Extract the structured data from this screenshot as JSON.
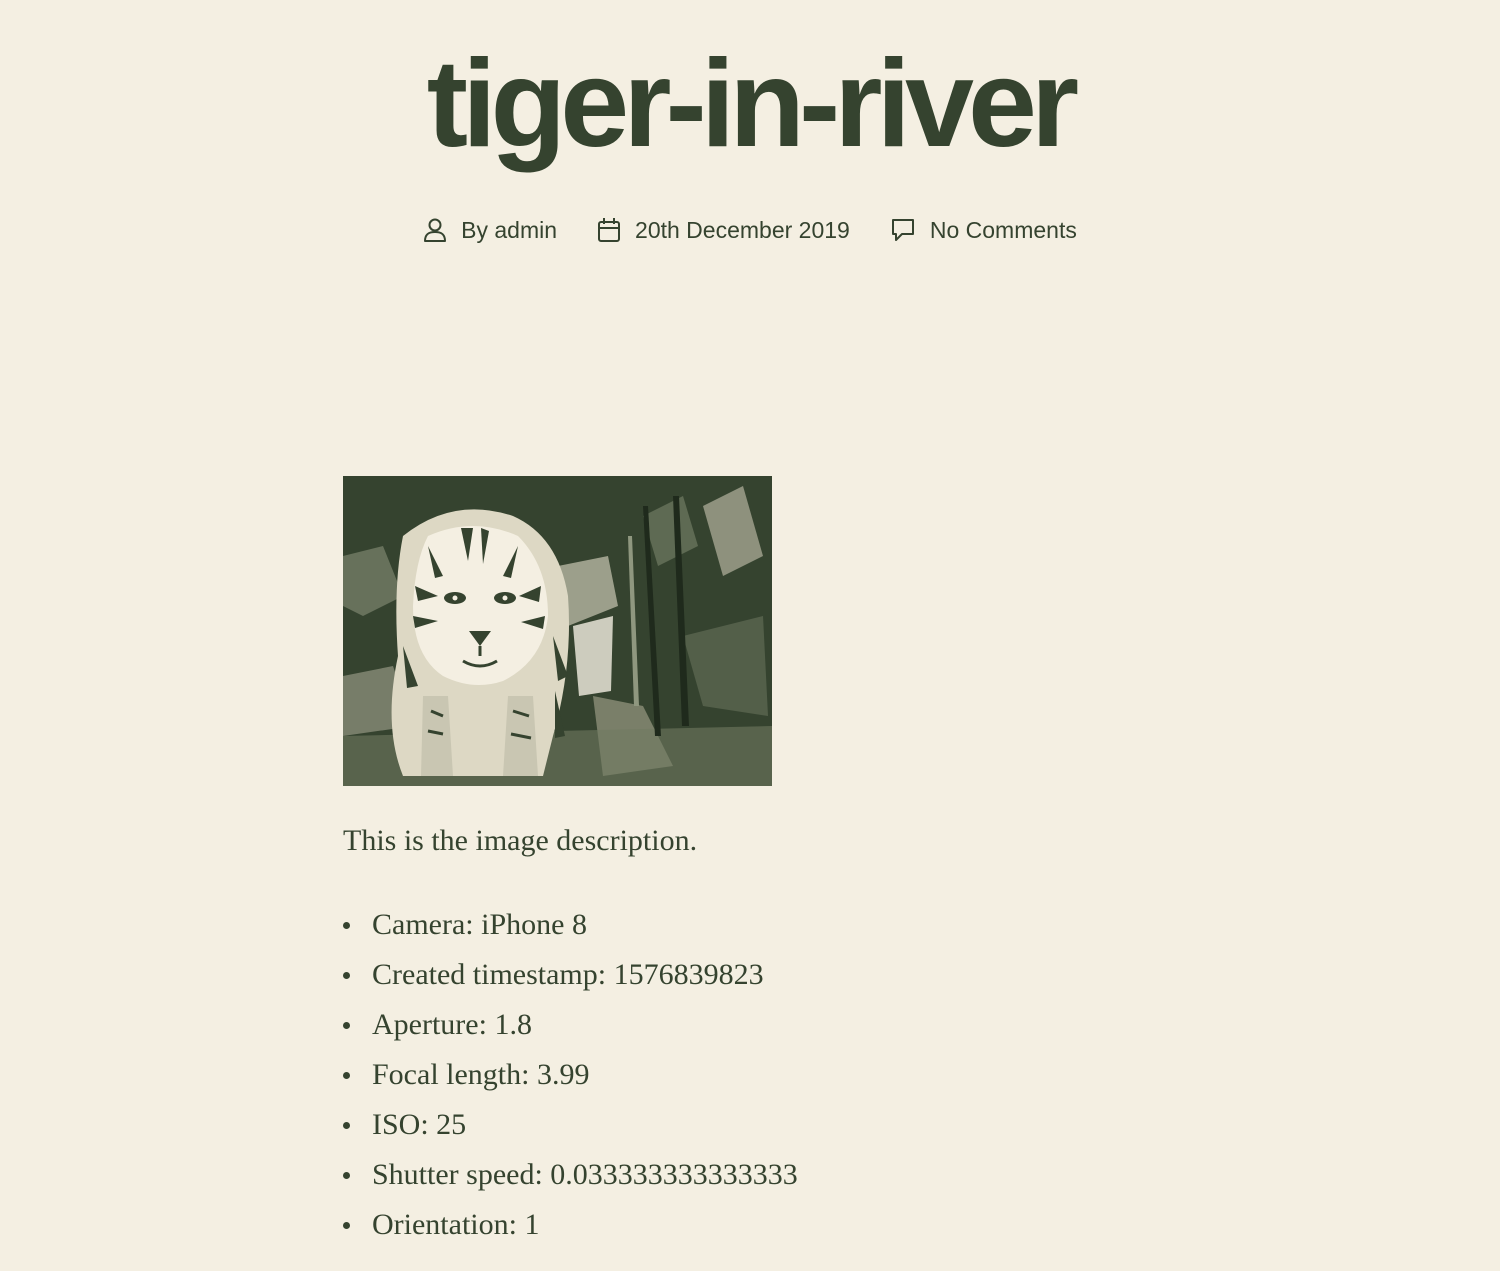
{
  "post": {
    "title": "tiger-in-river",
    "meta": {
      "author_label": "By admin",
      "date": "20th December 2019",
      "comments": "No Comments"
    },
    "image": {
      "alt": "tiger-in-river"
    },
    "description": "This is the image description.",
    "exif": [
      "Camera: iPhone 8",
      "Created timestamp: 1576839823",
      "Aperture: 1.8",
      "Focal length: 3.99",
      "ISO: 25",
      "Shutter speed: 0.033333333333333",
      "Orientation: 1"
    ]
  },
  "colors": {
    "background": "#f4efe2",
    "ink": "#35432f"
  },
  "icons": {
    "author": "user-icon",
    "date": "calendar-icon",
    "comments": "comment-bubble-icon"
  }
}
